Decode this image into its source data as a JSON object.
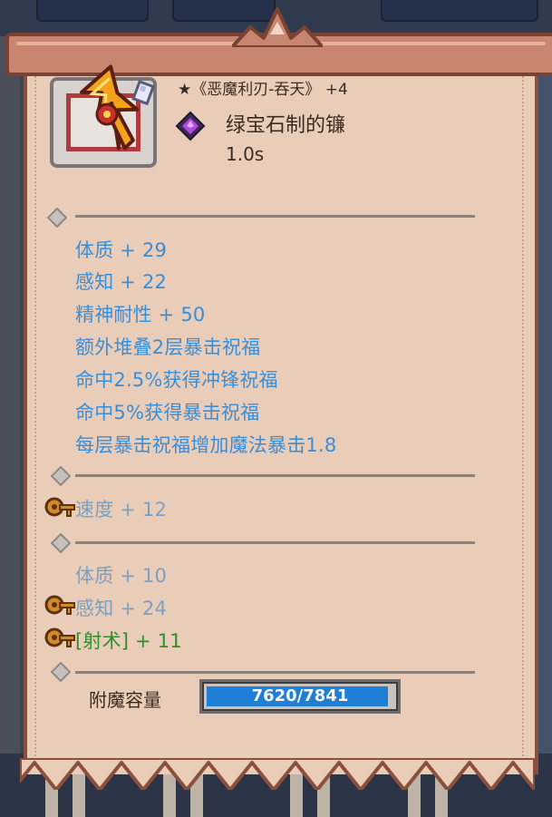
{
  "item": {
    "name": "★《恶魔利刃-吞天》 +4",
    "gem": "绿宝石制的镰",
    "attack_speed": "1.0s"
  },
  "stats_main": [
    "体质 + 29",
    "感知 + 22",
    "精神耐性 + 50",
    "额外堆叠2层暴击祝福",
    "命中2.5%获得冲锋祝福",
    "命中5%获得暴击祝福",
    "每层暴击祝福增加魔法暴击1.8"
  ],
  "stats_rune1": [
    "速度 + 12"
  ],
  "stats_rune2": [
    "体质 + 10",
    "感知 + 24",
    "[射术] + 11"
  ],
  "enchant": {
    "label": "附魔容量",
    "value": "7620/7841",
    "fraction": 0.972
  },
  "colors": {
    "stat_blue": "#3a8ed6",
    "stat_grey": "#7ba0c4",
    "stat_green": "#2f8f2f",
    "card_bg": "#e9cdb9",
    "enchant_fill": "#1f7fd6"
  },
  "icons": {
    "weapon": "demon-blade-icon",
    "gem": "purple-gem-icon",
    "rune": "rune-key-icon",
    "separator": "diamond-icon"
  }
}
